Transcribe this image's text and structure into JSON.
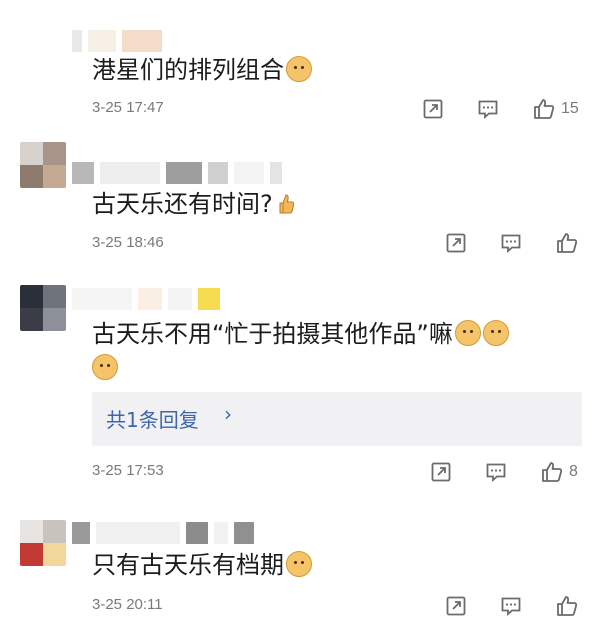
{
  "comments": [
    {
      "text": "港星们的排列组合",
      "time": "3-25 17:47",
      "likes": "15"
    },
    {
      "text": "古天乐还有时间?",
      "time": "3-25 18:46",
      "likes": ""
    },
    {
      "text_line1": "古天乐不用“忙于拍摄其他作品”嘛",
      "text_line2": "",
      "time": "3-25 17:53",
      "likes": "8",
      "reply_label": "共1条回复",
      "reply_arrow": "›"
    },
    {
      "text": "只有古天乐有档期",
      "time": "3-25 20:11",
      "likes": ""
    }
  ],
  "icons": [
    "share-icon",
    "comment-icon",
    "like-icon",
    "doge-emoji-icon",
    "thumbs-up-emoji-icon"
  ],
  "colors": {
    "link": "#3d67a8",
    "meta": "#7a7a7a",
    "reply_bg": "#f1f1f3"
  }
}
